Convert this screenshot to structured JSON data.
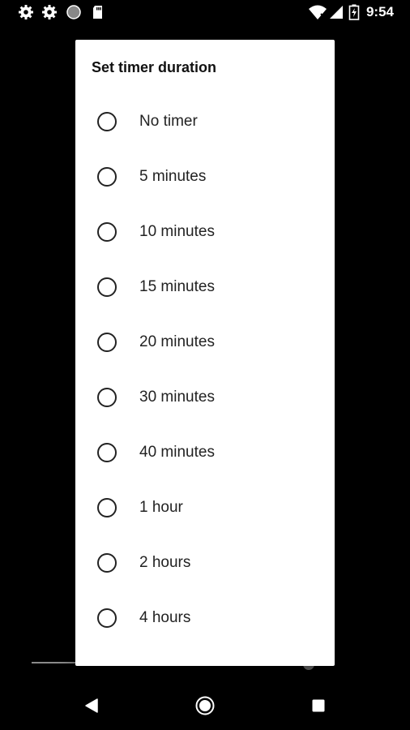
{
  "status_bar": {
    "time": "9:54",
    "left_icons": [
      "settings-icon",
      "settings-icon",
      "circle-icon",
      "sd-card-icon"
    ],
    "right_icons": [
      "wifi-icon",
      "signal-icon",
      "battery-charging-icon"
    ]
  },
  "dialog": {
    "title": "Set timer duration",
    "options": [
      {
        "label": "No timer",
        "selected": false
      },
      {
        "label": "5 minutes",
        "selected": false
      },
      {
        "label": "10 minutes",
        "selected": false
      },
      {
        "label": "15 minutes",
        "selected": false
      },
      {
        "label": "20 minutes",
        "selected": false
      },
      {
        "label": "30 minutes",
        "selected": false
      },
      {
        "label": "40 minutes",
        "selected": false
      },
      {
        "label": "1 hour",
        "selected": false
      },
      {
        "label": "2 hours",
        "selected": false
      },
      {
        "label": "4 hours",
        "selected": false
      }
    ]
  },
  "nav_bar": {
    "buttons": [
      "back-icon",
      "home-icon",
      "recents-icon"
    ]
  },
  "colors": {
    "screen_bg": "#000000",
    "dialog_bg": "#ffffff",
    "text": "#222222"
  }
}
